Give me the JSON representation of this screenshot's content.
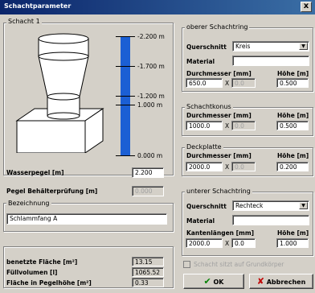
{
  "window": {
    "title": "Schachtparameter",
    "close_glyph": "x"
  },
  "left": {
    "title": "Schacht 1",
    "gauge_marks": [
      {
        "label": "-2.200 m",
        "value": -2.2
      },
      {
        "label": "-1.700 m",
        "value": -1.7
      },
      {
        "label": "-1.200 m",
        "value": -1.2
      },
      {
        "label": "1.000 m",
        "value": 1.0
      },
      {
        "label": "0.000 m",
        "value": 0.0
      }
    ],
    "wasserpegel_label": "Wasserpegel [m]",
    "wasserpegel_value": "2.200",
    "pegel_label": "Pegel Behälterprüfung [m]",
    "pegel_value": "0.000",
    "bezeichnung_title": "Bezeichnung",
    "bezeichnung_value": "Schlammfang A",
    "stats": {
      "flaeche_label": "benetzte Fläche [m²]",
      "flaeche_value": "13.15",
      "fuellvolumen_label": "Füllvolumen [l]",
      "fuellvolumen_value": "1065.52",
      "pegelhoehe_label": "Fläche in Pegelhöhe [m²]",
      "pegelhoehe_value": "0.33"
    }
  },
  "oberer": {
    "title": "oberer Schachtring",
    "querschnitt_label": "Querschnitt",
    "querschnitt_value": "Kreis",
    "material_label": "Material",
    "material_value": "",
    "durchmesser_label": "Durchmesser [mm]",
    "hoehe_label": "Höhe [m]",
    "d1": "650.0",
    "x": "X",
    "d2": "0.0",
    "hoehe": "0.500"
  },
  "konus": {
    "title": "Schachtkonus",
    "durchmesser_label": "Durchmesser [mm]",
    "hoehe_label": "Höhe [m]",
    "d1": "1000.0",
    "x": "X",
    "d2": "0.0",
    "hoehe": "0.500"
  },
  "deckplatte": {
    "title": "Deckplatte",
    "durchmesser_label": "Durchmesser [mm]",
    "hoehe_label": "Höhe [m]",
    "d1": "2000.0",
    "x": "X",
    "d2": "0.0",
    "hoehe": "0.200"
  },
  "unterer": {
    "title": "unterer Schachtring",
    "querschnitt_label": "Querschnitt",
    "querschnitt_value": "Rechteck",
    "material_label": "Material",
    "material_value": "",
    "kanten_label": "Kantenlängen [mm]",
    "hoehe_label": "Höhe [m]",
    "d1": "2000.0",
    "x": "X",
    "d2": "0.0",
    "hoehe": "1.000"
  },
  "checkbox_label": "Schacht sitzt auf Grundkörper",
  "ok_label": "OK",
  "cancel_label": "Abbrechen",
  "colors": {
    "gauge": "#1b5fd4",
    "titlebar": "#0a246a",
    "ok_check": "#008000",
    "cancel_x": "#c00000"
  }
}
